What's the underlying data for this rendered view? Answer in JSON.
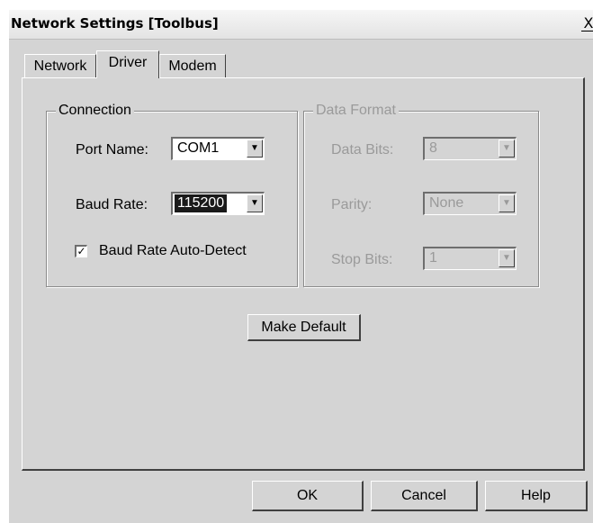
{
  "window": {
    "title": "Network Settings [Toolbus]",
    "close_glyph": "X"
  },
  "tabs": [
    {
      "label": "Network",
      "active": false
    },
    {
      "label": "Driver",
      "active": true
    },
    {
      "label": "Modem",
      "active": false
    }
  ],
  "connection": {
    "title": "Connection",
    "port_name_label": "Port Name:",
    "port_name_value": "COM1",
    "baud_rate_label": "Baud Rate:",
    "baud_rate_value": "115200",
    "auto_detect_label": "Baud Rate Auto-Detect",
    "auto_detect_checked": true,
    "check_glyph": "✓"
  },
  "data_format": {
    "title": "Data Format",
    "data_bits_label": "Data Bits:",
    "data_bits_value": "8",
    "parity_label": "Parity:",
    "parity_value": "None",
    "stop_bits_label": "Stop Bits:",
    "stop_bits_value": "1",
    "enabled": false
  },
  "make_default_label": "Make Default",
  "footer": {
    "ok_label": "OK",
    "cancel_label": "Cancel",
    "help_label": "Help"
  },
  "dropdown_glyph": "▼"
}
